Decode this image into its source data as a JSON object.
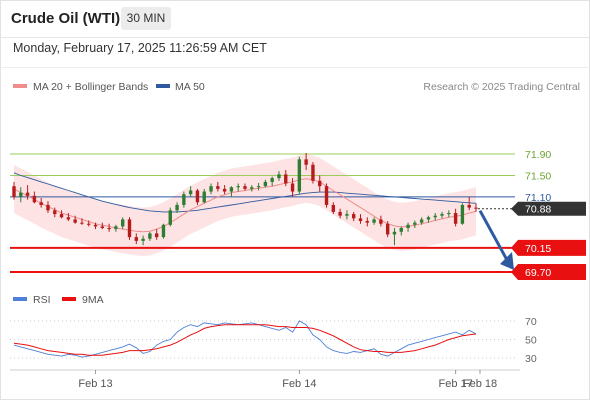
{
  "header": {
    "title": "Crude Oil (WTI)",
    "timeframe": "30 MIN"
  },
  "timestamp": "Monday, February 17, 2025 11:26:59 AM CET",
  "colors": {
    "ma20": "#f08c8c",
    "ma50": "#2f5aa0",
    "band_fill": "#fde0e0",
    "resistance": "#9acd5a",
    "support": "#e81010",
    "pivot": "#2f5aa0",
    "rsi": "#4f7fd6",
    "rsi_ma": "#e81010",
    "up": "#2e7d32",
    "down": "#b71c1c"
  },
  "legend": {
    "ma20_label": "MA 20 + Bollinger Bands",
    "ma50_label": "MA 50",
    "copyright": "Research © 2025 Trading Central"
  },
  "rsi_legend": {
    "rsi_label": "RSI",
    "ma_label": "9MA"
  },
  "chart_data": {
    "type": "candlestick",
    "x_labels": [
      "Feb 13",
      "Feb 14",
      "Feb 17",
      "Feb 18"
    ],
    "price_range": [
      69.4,
      72.3
    ],
    "levels": {
      "resistance": [
        {
          "value": 71.9,
          "label": "71.90"
        },
        {
          "value": 71.5,
          "label": "71.50"
        }
      ],
      "pivot": {
        "value": 71.1,
        "label": "71.10"
      },
      "current": {
        "value": 70.88,
        "label": "70.88"
      },
      "support": [
        {
          "value": 70.15,
          "label": "70.15"
        },
        {
          "value": 69.7,
          "label": "69.70"
        }
      ]
    },
    "rsi": {
      "ticks": [
        {
          "value": 70,
          "label": "70"
        },
        {
          "value": 50,
          "label": "50"
        },
        {
          "value": 30,
          "label": "30"
        }
      ],
      "range": [
        20,
        80
      ]
    },
    "candles": [
      [
        71.3,
        71.38,
        71.05,
        71.1
      ],
      [
        71.1,
        71.28,
        71.0,
        71.18
      ],
      [
        71.18,
        71.32,
        71.05,
        71.12
      ],
      [
        71.12,
        71.2,
        70.98,
        71.0
      ],
      [
        71.0,
        71.08,
        70.9,
        70.95
      ],
      [
        70.95,
        71.02,
        70.8,
        70.85
      ],
      [
        70.85,
        70.9,
        70.72,
        70.78
      ],
      [
        70.78,
        70.85,
        70.7,
        70.72
      ],
      [
        70.72,
        70.8,
        70.65,
        70.68
      ],
      [
        70.68,
        70.75,
        70.6,
        70.62
      ],
      [
        70.62,
        70.7,
        70.58,
        70.6
      ],
      [
        70.6,
        70.66,
        70.55,
        70.58
      ],
      [
        70.58,
        70.62,
        70.5,
        70.55
      ],
      [
        70.55,
        70.62,
        70.5,
        70.52
      ],
      [
        70.52,
        70.6,
        70.45,
        70.5
      ],
      [
        70.5,
        70.58,
        70.45,
        70.55
      ],
      [
        70.55,
        70.72,
        70.5,
        70.68
      ],
      [
        70.68,
        70.72,
        70.3,
        70.35
      ],
      [
        70.35,
        70.42,
        70.22,
        70.28
      ],
      [
        70.28,
        70.38,
        70.2,
        70.32
      ],
      [
        70.32,
        70.45,
        70.28,
        70.42
      ],
      [
        70.42,
        70.5,
        70.3,
        70.35
      ],
      [
        70.35,
        70.6,
        70.32,
        70.58
      ],
      [
        70.58,
        70.9,
        70.55,
        70.85
      ],
      [
        70.85,
        71.0,
        70.8,
        70.95
      ],
      [
        70.95,
        71.2,
        70.9,
        71.15
      ],
      [
        71.15,
        71.3,
        71.1,
        71.22
      ],
      [
        71.22,
        71.25,
        70.95,
        71.0
      ],
      [
        71.0,
        71.25,
        70.98,
        71.2
      ],
      [
        71.2,
        71.35,
        71.15,
        71.3
      ],
      [
        71.3,
        71.38,
        71.2,
        71.25
      ],
      [
        71.25,
        71.32,
        71.15,
        71.2
      ],
      [
        71.2,
        71.3,
        71.1,
        71.28
      ],
      [
        71.28,
        71.35,
        71.2,
        71.3
      ],
      [
        71.3,
        71.35,
        71.22,
        71.25
      ],
      [
        71.25,
        71.32,
        71.2,
        71.28
      ],
      [
        71.28,
        71.36,
        71.22,
        71.3
      ],
      [
        71.3,
        71.42,
        71.28,
        71.38
      ],
      [
        71.38,
        71.48,
        71.3,
        71.45
      ],
      [
        71.45,
        71.58,
        71.4,
        71.52
      ],
      [
        71.52,
        71.6,
        71.3,
        71.35
      ],
      [
        71.35,
        71.45,
        71.1,
        71.2
      ],
      [
        71.2,
        71.85,
        71.15,
        71.8
      ],
      [
        71.8,
        71.92,
        71.6,
        71.7
      ],
      [
        71.7,
        71.75,
        71.35,
        71.4
      ],
      [
        71.4,
        71.5,
        71.2,
        71.3
      ],
      [
        71.3,
        71.35,
        70.9,
        70.95
      ],
      [
        70.95,
        71.0,
        70.78,
        70.82
      ],
      [
        70.82,
        70.88,
        70.7,
        70.75
      ],
      [
        70.75,
        70.85,
        70.68,
        70.78
      ],
      [
        70.78,
        70.82,
        70.65,
        70.7
      ],
      [
        70.7,
        70.78,
        70.6,
        70.65
      ],
      [
        70.65,
        70.72,
        70.55,
        70.62
      ],
      [
        70.62,
        70.72,
        70.58,
        70.68
      ],
      [
        70.68,
        70.75,
        70.55,
        70.6
      ],
      [
        70.6,
        70.65,
        70.35,
        70.4
      ],
      [
        70.4,
        70.52,
        70.2,
        70.45
      ],
      [
        70.45,
        70.55,
        70.38,
        70.52
      ],
      [
        70.52,
        70.62,
        70.45,
        70.58
      ],
      [
        70.58,
        70.66,
        70.52,
        70.62
      ],
      [
        70.62,
        70.72,
        70.58,
        70.68
      ],
      [
        70.68,
        70.75,
        70.62,
        70.72
      ],
      [
        70.72,
        70.8,
        70.66,
        70.75
      ],
      [
        70.75,
        70.82,
        70.7,
        70.78
      ],
      [
        70.78,
        70.85,
        70.72,
        70.8
      ],
      [
        70.8,
        70.88,
        70.55,
        70.6
      ],
      [
        70.6,
        70.98,
        70.58,
        70.95
      ],
      [
        70.95,
        71.1,
        70.85,
        70.9
      ],
      [
        70.9,
        70.98,
        70.82,
        70.88
      ]
    ],
    "ma20": [
      71.25,
      71.18,
      71.12,
      71.05,
      70.98,
      70.92,
      70.86,
      70.8,
      70.76,
      70.72,
      70.68,
      70.64,
      70.6,
      70.57,
      70.55,
      70.52,
      70.5,
      70.48,
      70.46,
      70.45,
      70.46,
      70.5,
      70.55,
      70.62,
      70.7,
      70.78,
      70.86,
      70.92,
      70.98,
      71.04,
      71.1,
      71.14,
      71.18,
      71.2,
      71.22,
      71.24,
      71.26,
      71.28,
      71.3,
      71.33,
      71.36,
      71.38,
      71.42,
      71.44,
      71.42,
      71.38,
      71.3,
      71.22,
      71.14,
      71.06,
      70.98,
      70.9,
      70.82,
      70.74,
      70.66,
      70.6,
      70.56,
      70.54,
      70.55,
      70.57,
      70.6,
      70.63,
      70.66,
      70.69,
      70.72,
      70.74,
      70.76,
      70.8,
      70.83
    ],
    "ma50": [
      71.55,
      71.5,
      71.46,
      71.42,
      71.38,
      71.34,
      71.3,
      71.26,
      71.22,
      71.18,
      71.14,
      71.1,
      71.06,
      71.02,
      70.99,
      70.96,
      70.93,
      70.9,
      70.88,
      70.86,
      70.84,
      70.83,
      70.82,
      70.82,
      70.82,
      70.83,
      70.84,
      70.85,
      70.87,
      70.89,
      70.91,
      70.93,
      70.95,
      70.97,
      70.99,
      71.01,
      71.03,
      71.05,
      71.07,
      71.09,
      71.11,
      71.13,
      71.15,
      71.17,
      71.18,
      71.19,
      71.19,
      71.19,
      71.18,
      71.17,
      71.16,
      71.15,
      71.14,
      71.13,
      71.12,
      71.11,
      71.1,
      71.09,
      71.08,
      71.07,
      71.06,
      71.05,
      71.04,
      71.03,
      71.02,
      71.01,
      71.0,
      70.99,
      70.98
    ],
    "rsi_values": [
      44,
      42,
      40,
      38,
      36,
      34,
      33,
      32,
      34,
      33,
      31,
      32,
      34,
      36,
      38,
      40,
      42,
      45,
      41,
      35,
      37,
      44,
      48,
      50,
      58,
      63,
      66,
      64,
      68,
      67,
      66,
      68,
      67,
      66,
      67,
      68,
      66,
      64,
      62,
      60,
      63,
      58,
      70,
      66,
      55,
      50,
      42,
      38,
      36,
      35,
      37,
      36,
      38,
      40,
      34,
      32,
      36,
      40,
      44,
      46,
      48,
      50,
      52,
      54,
      56,
      58,
      55,
      60,
      56
    ],
    "rsi_ma": [
      46,
      45,
      44,
      42,
      40,
      38,
      37,
      36,
      35,
      34,
      34,
      33,
      33,
      33,
      34,
      35,
      36,
      38,
      38,
      38,
      39,
      40,
      42,
      44,
      47,
      51,
      55,
      58,
      62,
      64,
      65,
      66,
      66,
      66,
      66,
      66,
      66,
      66,
      65,
      64,
      64,
      63,
      63,
      63,
      62,
      60,
      57,
      54,
      50,
      46,
      42,
      39,
      38,
      37,
      37,
      36,
      36,
      36,
      37,
      38,
      40,
      42,
      44,
      47,
      50,
      52,
      54,
      55,
      56
    ]
  }
}
